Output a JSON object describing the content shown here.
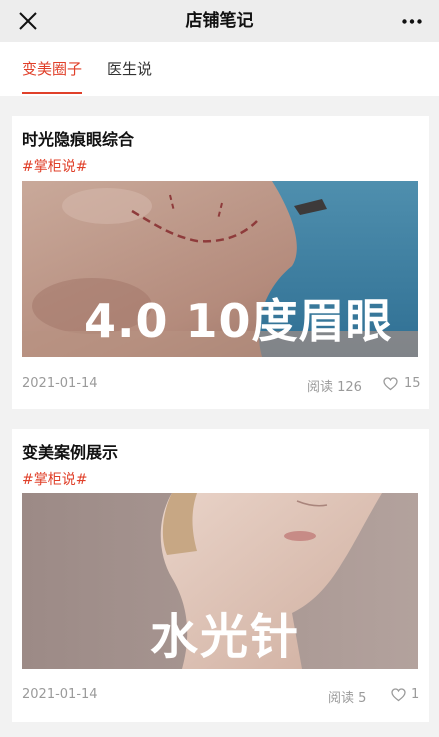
{
  "header": {
    "title": "店铺笔记",
    "close_icon": "close-icon",
    "more_icon": "more-dots-icon"
  },
  "tabs": [
    {
      "label": "变美圈子",
      "active": true
    },
    {
      "label": "医生说",
      "active": false
    }
  ],
  "notes": [
    {
      "title": "时光隐痕眼综合",
      "tag": "#掌柜说#",
      "image_text": "4.0 10度眉眼",
      "date": "2021-01-14",
      "reads": "阅读 126",
      "likes": "15"
    },
    {
      "title": "变美案例展示",
      "tag": "#掌柜说#",
      "image_text": "水光针",
      "date": "2021-01-14",
      "reads": "阅读 5",
      "likes": "1"
    }
  ],
  "colors": {
    "accent": "#e0402a",
    "meta": "#9a9a9a",
    "background": "#f2f2f2"
  }
}
